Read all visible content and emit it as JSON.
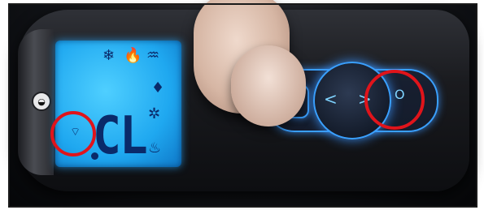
{
  "image": {
    "subject": "gas fireplace remote control with backlit LCD and blue touch keys"
  },
  "remote": {
    "brand_logo": "brand-logo",
    "display": {
      "digits": "CL",
      "icons": [
        "snowflake-icon",
        "flame-icon",
        "thermostat-icon",
        "flame-small-icon",
        "snowflake-icon",
        "flame-icon",
        "wireless-signal-icon"
      ]
    },
    "keys": {
      "left_arrow": "<",
      "right_arrow": ">",
      "power_symbol": "O"
    }
  },
  "annotations": {
    "color": "#e0141b",
    "circles": [
      "left-callout-circle",
      "right-callout-circle"
    ]
  }
}
